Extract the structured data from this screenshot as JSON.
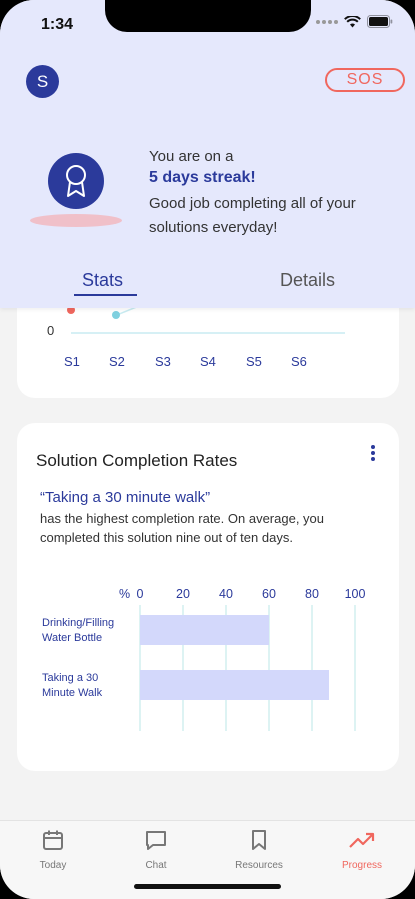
{
  "status_bar": {
    "time": "1:34"
  },
  "header": {
    "avatar_initial": "S",
    "sos_label": "SOS",
    "streak_line1": "You are on a",
    "streak_line2": "5 days streak!",
    "streak_line3": "Good job completing all of your solutions everyday!",
    "tabs": [
      {
        "label": "Stats"
      },
      {
        "label": "Details"
      }
    ],
    "active_tab": "Stats"
  },
  "streak_chart": {
    "y_label": "0",
    "x_labels": [
      "S1",
      "S2",
      "S3",
      "S4",
      "S5",
      "S6"
    ]
  },
  "completion_card": {
    "title": "Solution Completion Rates",
    "highlight": "“Taking a 30 minute walk”",
    "description": "has the highest completion rate. On average, you completed this solution nine out of ten days."
  },
  "chart_data": {
    "type": "bar",
    "orientation": "horizontal",
    "xlabel": "%",
    "xlim": [
      0,
      100
    ],
    "tick_labels": [
      "0",
      "20",
      "40",
      "60",
      "80",
      "100"
    ],
    "categories": [
      "Drinking/Filling Water Bottle",
      "Taking a 30 Minute Walk"
    ],
    "values": [
      60,
      88
    ],
    "grid": true
  },
  "tab_bar": {
    "items": [
      {
        "label": "Today",
        "icon": "calendar-icon"
      },
      {
        "label": "Chat",
        "icon": "chat-bubble-icon"
      },
      {
        "label": "Resources",
        "icon": "bookmark-icon"
      },
      {
        "label": "Progress",
        "icon": "trending-up-icon"
      }
    ],
    "active": "Progress"
  },
  "colors": {
    "primary": "#2b3a9b",
    "accent": "#f0675e",
    "header_bg": "#e5e8fc",
    "bar_fill": "#d3d8fb"
  }
}
